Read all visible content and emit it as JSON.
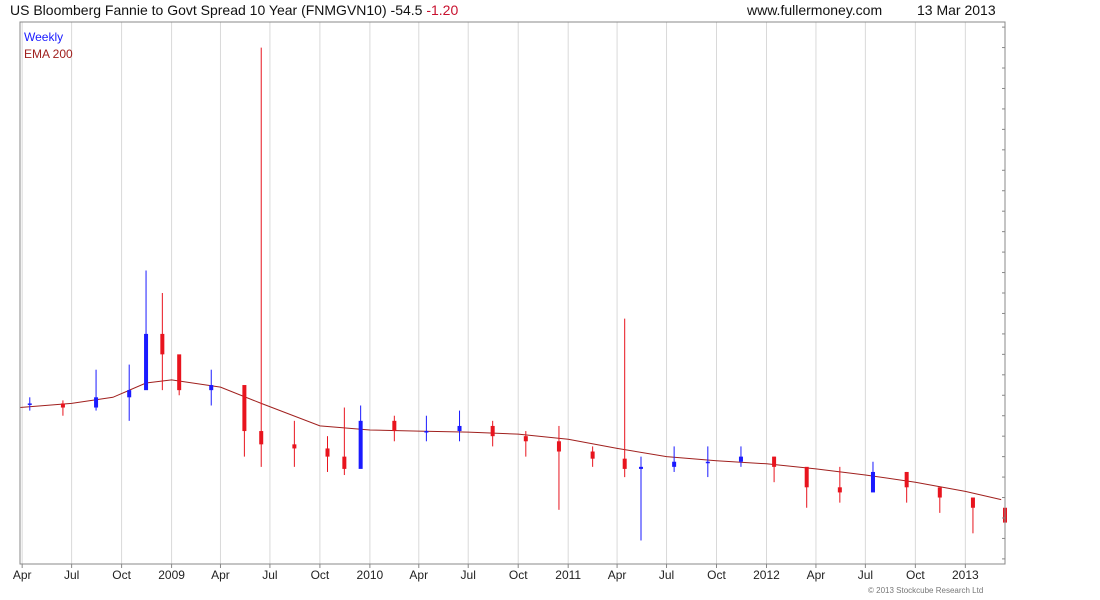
{
  "header": {
    "title": "US Bloomberg Fannie to Govt Spread 10 Year (FNMGVN10)",
    "last_value": "-54.5",
    "change": "-1.20",
    "website": "www.fullermoney.com",
    "date": "13 Mar 2013"
  },
  "legend": {
    "weekly": "Weekly",
    "ema": "EMA 200"
  },
  "copyright": "© 2013 Stockcube Research Ltd",
  "colors": {
    "up": "#1a1aff",
    "down": "#e8141e",
    "ema": "#a0201e",
    "grid": "#d9d9d9",
    "frame": "#888888"
  },
  "chart_data": {
    "type": "line",
    "title": "US Bloomberg Fannie to Govt Spread 10 Year (FNMGVN10)",
    "interval": "weekly",
    "x_tick_labels": [
      "Apr",
      "Jul",
      "Oct",
      "2009",
      "Apr",
      "Jul",
      "Oct",
      "2010",
      "Apr",
      "Jul",
      "Oct",
      "2011",
      "Apr",
      "Jul",
      "Oct",
      "2012",
      "Apr",
      "Jul",
      "Oct",
      "2013"
    ],
    "xlim": [
      "2008-03-28",
      "2013-03-15"
    ],
    "y_ticks": [
      0,
      100,
      200,
      300,
      400
    ],
    "ylim": [
      -95,
      435
    ],
    "grid": true,
    "legend_position": "top-left",
    "series": [
      {
        "name": "Weekly",
        "style": "candlestick",
        "x": [
          "2008-04",
          "2008-06",
          "2008-08",
          "2008-10",
          "2008-11",
          "2008-12",
          "2009-01",
          "2009-03",
          "2009-05",
          "2009-06",
          "2009-08",
          "2009-10",
          "2009-11",
          "2009-12",
          "2010-02",
          "2010-04",
          "2010-06",
          "2010-08",
          "2010-10",
          "2010-12",
          "2011-02",
          "2011-04",
          "2011-05",
          "2011-07",
          "2011-09",
          "2011-11",
          "2012-01",
          "2012-03",
          "2012-05",
          "2012-07",
          "2012-09",
          "2012-11",
          "2013-01",
          "2013-03"
        ],
        "close": [
          62,
          58,
          68,
          75,
          130,
          110,
          75,
          80,
          35,
          22,
          18,
          10,
          -2,
          45,
          35,
          35,
          40,
          30,
          25,
          15,
          8,
          -2,
          0,
          5,
          5,
          10,
          0,
          -20,
          -25,
          -5,
          -20,
          -30,
          -40,
          -54.5
        ],
        "high": [
          68,
          65,
          95,
          100,
          192,
          170,
          95,
          95,
          60,
          410,
          45,
          30,
          58,
          60,
          50,
          50,
          55,
          45,
          35,
          40,
          20,
          145,
          10,
          20,
          20,
          20,
          10,
          -5,
          0,
          5,
          -5,
          -20,
          -30,
          -45
        ],
        "low": [
          55,
          50,
          55,
          45,
          95,
          75,
          70,
          60,
          10,
          0,
          0,
          -5,
          -8,
          25,
          25,
          25,
          25,
          20,
          10,
          -42,
          0,
          -10,
          -72,
          -5,
          -10,
          0,
          -15,
          -40,
          -35,
          -15,
          -35,
          -45,
          -65,
          -58
        ]
      },
      {
        "name": "EMA 200",
        "style": "line",
        "x": [
          "2008-03-28",
          "2008-07-01",
          "2008-09-15",
          "2008-11-15",
          "2009-01-01",
          "2009-04-01",
          "2009-06-15",
          "2009-10-01",
          "2010-01-01",
          "2010-04-01",
          "2010-07-01",
          "2010-10-01",
          "2011-01-01",
          "2011-04-01",
          "2011-07-01",
          "2011-10-01",
          "2012-01-01",
          "2012-04-01",
          "2012-07-01",
          "2012-10-01",
          "2013-01-01",
          "2013-03-08"
        ],
        "values": [
          58,
          62,
          68,
          82,
          85,
          78,
          62,
          40,
          36,
          35,
          34,
          32,
          27,
          18,
          10,
          6,
          3,
          -2,
          -8,
          -15,
          -24,
          -32
        ]
      }
    ]
  }
}
